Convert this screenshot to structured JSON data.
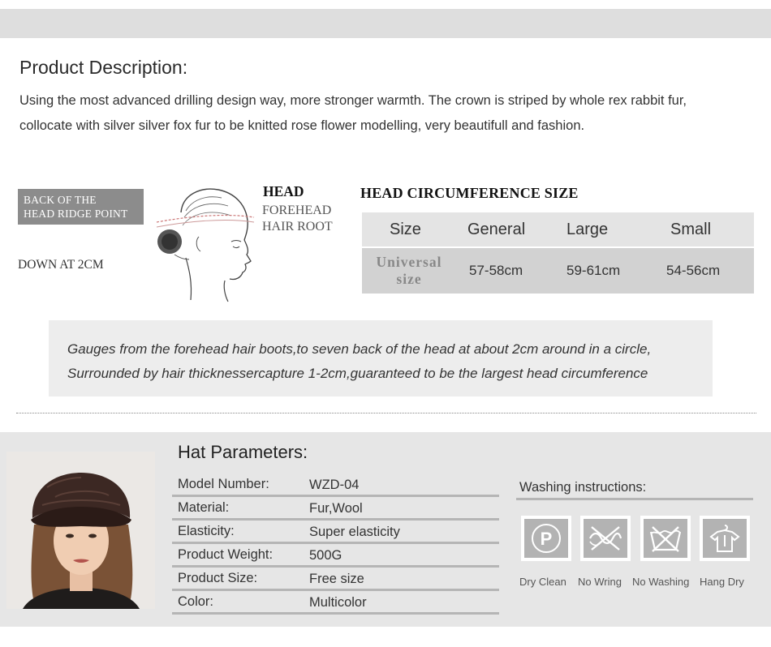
{
  "description": {
    "title": "Product Description:",
    "text_line1": "Using the most advanced drilling design way, more stronger warmth. The crown is striped by whole rex rabbit fur,",
    "text_line2": "collocate with silver silver fox fur to be knitted rose flower modelling, very beautifull and fashion."
  },
  "guide": {
    "back_line1": "BACK OF THE",
    "back_line2": "HEAD RIDGE POINT",
    "down": "DOWN AT 2CM",
    "head": "HEAD",
    "forehead_line1": "FOREHEAD",
    "forehead_line2": "HAIR ROOT"
  },
  "size_chart": {
    "title": "HEAD CIRCUMFERENCE SIZE",
    "headers": [
      "Size",
      "General",
      "Large",
      "Small"
    ],
    "row_label_line1": "Universal",
    "row_label_line2": "size",
    "values": [
      "57-58cm",
      "59-61cm",
      "54-56cm"
    ]
  },
  "gauge": {
    "line1": "Gauges from the forehead hair boots,to seven back of the head at about 2cm around in a circle,",
    "line2": "Surrounded by hair thicknessercapture 1-2cm,guaranteed to be the largest head circumference"
  },
  "parameters": {
    "title": "Hat Parameters:",
    "rows": [
      {
        "key": "Model Number:",
        "value": "WZD-04"
      },
      {
        "key": "Material:",
        "value": "Fur,Wool"
      },
      {
        "key": "Elasticity:",
        "value": "Super elasticity"
      },
      {
        "key": "Product Weight:",
        "value": "500G"
      },
      {
        "key": "Product Size:",
        "value": "Free size"
      },
      {
        "key": "Color:",
        "value": "Multicolor"
      }
    ]
  },
  "washing": {
    "title": "Washing instructions:",
    "items": [
      {
        "icon": "dry-clean-icon",
        "label": "Dry Clean",
        "glyph": "P"
      },
      {
        "icon": "no-wring-icon",
        "label": "No Wring"
      },
      {
        "icon": "no-washing-icon",
        "label": "No Washing"
      },
      {
        "icon": "hang-dry-icon",
        "label": "Hang Dry"
      }
    ]
  }
}
